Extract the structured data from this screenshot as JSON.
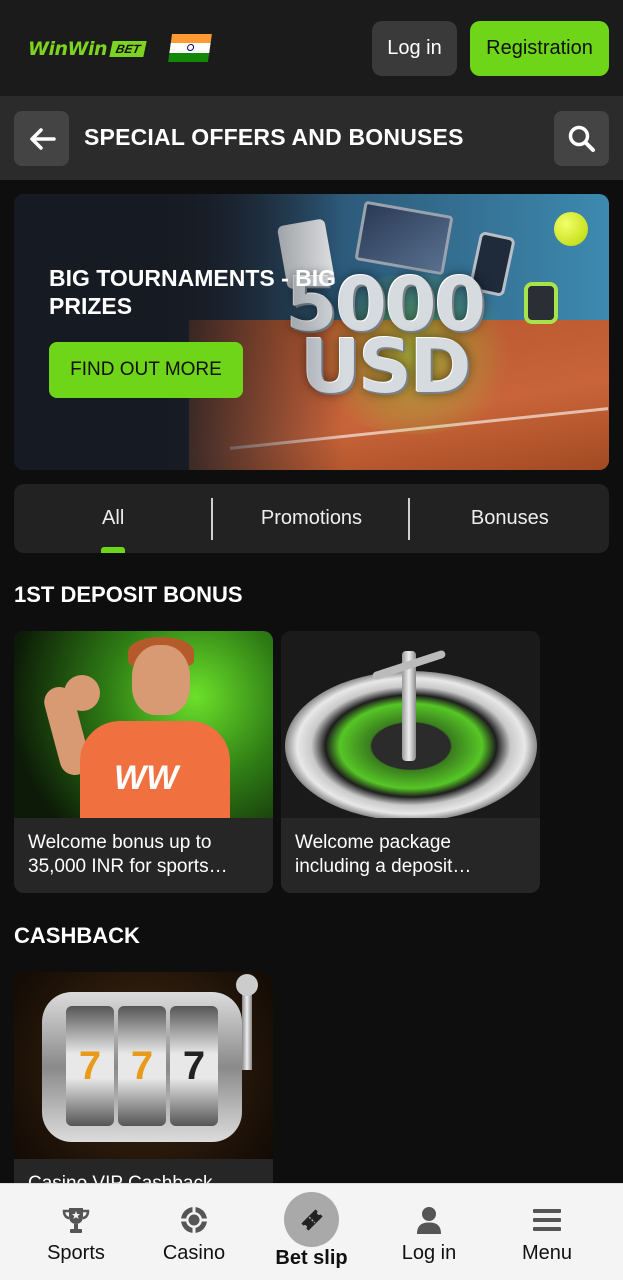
{
  "header": {
    "logo_text": "WinWin",
    "logo_badge": "BET",
    "login_label": "Log in",
    "register_label": "Registration"
  },
  "title_bar": {
    "title": "SPECIAL OFFERS AND BONUSES"
  },
  "hero": {
    "title": "BIG TOURNAMENTS - BIG PRIZES",
    "button_label": "FIND OUT MORE",
    "amount_top": "5000",
    "amount_bottom": "USD"
  },
  "tabs": [
    {
      "label": "All",
      "active": true
    },
    {
      "label": "Promotions",
      "active": false
    },
    {
      "label": "Bonuses",
      "active": false
    }
  ],
  "sections": [
    {
      "title": "1ST DEPOSIT BONUS",
      "cards": [
        {
          "text": "Welcome bonus up to 35,000 INR for sports…"
        },
        {
          "text": "Welcome package including a deposit…"
        }
      ]
    },
    {
      "title": "CASHBACK",
      "cards": [
        {
          "text": "Casino VIP Cashback"
        }
      ]
    }
  ],
  "slot_reels": [
    "7",
    "7",
    "7"
  ],
  "bottom_nav": [
    {
      "label": "Sports",
      "icon": "trophy-icon"
    },
    {
      "label": "Casino",
      "icon": "casino-chip-icon"
    },
    {
      "label": "Bet slip",
      "icon": "ticket-icon"
    },
    {
      "label": "Log in",
      "icon": "user-icon"
    },
    {
      "label": "Menu",
      "icon": "menu-icon"
    }
  ],
  "colors": {
    "accent": "#6fd519",
    "background": "#0e0e0e",
    "header": "#1b1b1b",
    "title_bar": "#2b2b2b"
  }
}
